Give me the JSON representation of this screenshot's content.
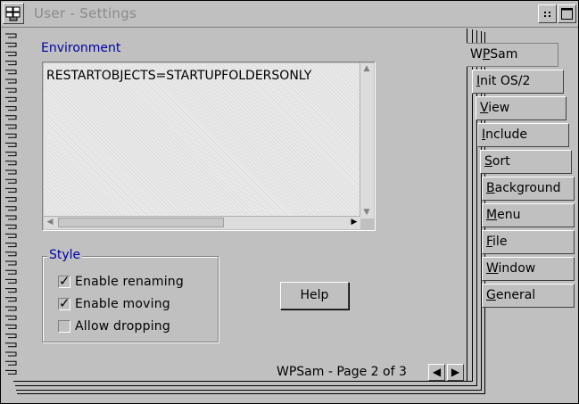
{
  "window": {
    "title": "User - Settings"
  },
  "environment": {
    "label": "Environment",
    "value": "RESTARTOBJECTS=STARTUPFOLDERSONLY"
  },
  "style": {
    "label": "Style",
    "options": [
      {
        "label": "Enable renaming",
        "checked": true
      },
      {
        "label": "Enable moving",
        "checked": true
      },
      {
        "label": "Allow dropping",
        "checked": false
      }
    ]
  },
  "help_button": {
    "label": "Help"
  },
  "page_indicator": {
    "text": "WPSam - Page 2 of 3"
  },
  "tabs": [
    {
      "pre": "W",
      "u": "P",
      "post": "Sam",
      "active": true
    },
    {
      "pre": "",
      "u": "I",
      "post": "nit OS/2"
    },
    {
      "pre": "",
      "u": "V",
      "post": "iew"
    },
    {
      "pre": "",
      "u": "I",
      "post": "nclude"
    },
    {
      "pre": "",
      "u": "S",
      "post": "ort"
    },
    {
      "pre": "",
      "u": "B",
      "post": "ackground"
    },
    {
      "pre": "",
      "u": "M",
      "post": "enu"
    },
    {
      "pre": "",
      "u": "F",
      "post": "ile"
    },
    {
      "pre": "",
      "u": "W",
      "post": "indow"
    },
    {
      "pre": "",
      "u": "G",
      "post": "eneral"
    }
  ],
  "icons": {
    "system_menu": "system-menu-icon",
    "restore": "restore-icon",
    "maximize": "maximize-icon",
    "prev_page": "arrow-left-icon",
    "next_page": "arrow-right-icon"
  }
}
